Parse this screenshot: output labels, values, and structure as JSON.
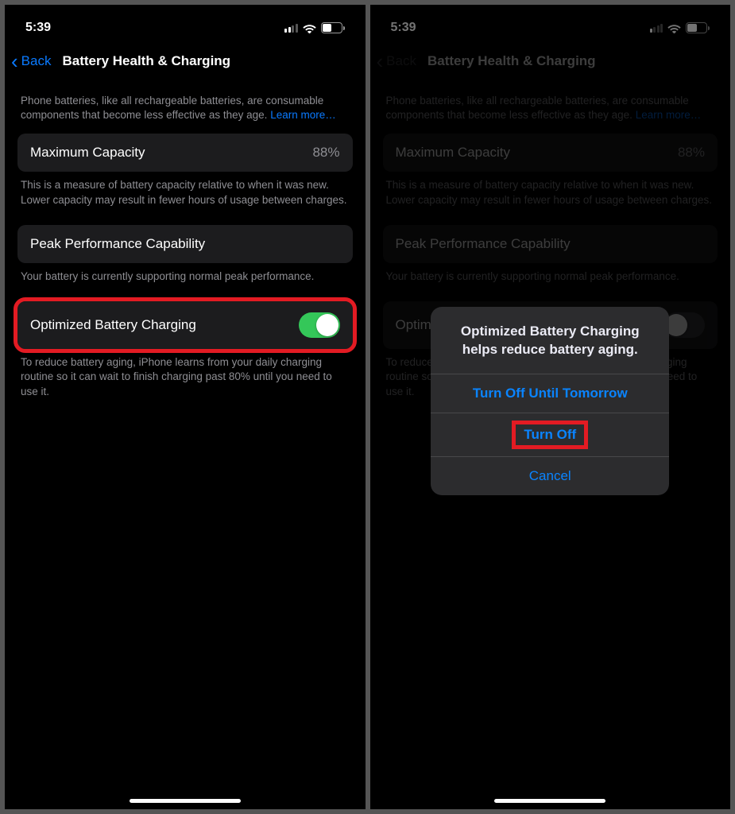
{
  "status": {
    "time": "5:39",
    "battery_pct": "51",
    "battery_fill_pct": 51,
    "signal_bars_on": 2
  },
  "nav": {
    "back": "Back",
    "title": "Battery Health & Charging"
  },
  "intro": {
    "text": "Phone batteries, like all rechargeable batteries, are consumable components that become less effective as they age. ",
    "link": "Learn more…"
  },
  "capacity": {
    "label": "Maximum Capacity",
    "value": "88%",
    "note": "This is a measure of battery capacity relative to when it was new. Lower capacity may result in fewer hours of usage between charges."
  },
  "peak": {
    "label": "Peak Performance Capability",
    "note": "Your battery is currently supporting normal peak performance."
  },
  "optimized": {
    "label": "Optimized Battery Charging",
    "note": "To reduce battery aging, iPhone learns from your daily charging routine so it can wait to finish charging past 80% until you need to use it."
  },
  "sheet": {
    "title": "Optimized Battery Charging helps reduce battery aging.",
    "opt1": "Turn Off Until Tomorrow",
    "opt2": "Turn Off",
    "cancel": "Cancel"
  }
}
